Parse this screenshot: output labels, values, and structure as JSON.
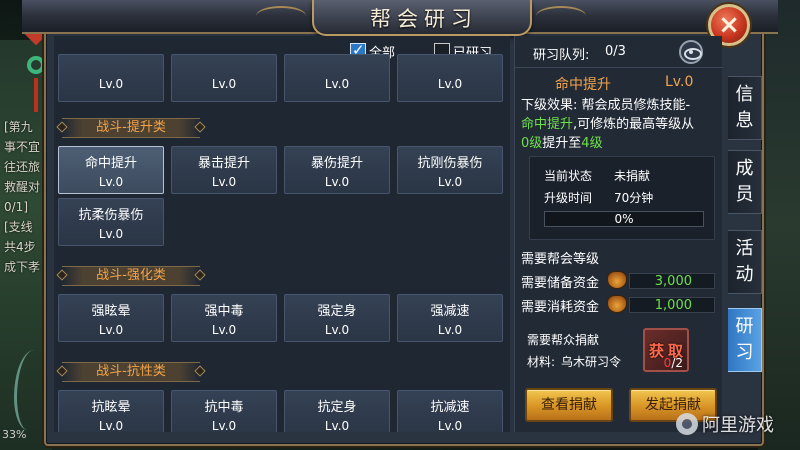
{
  "title": "帮会研习",
  "filters": {
    "all_label": "全部",
    "all_checked": true,
    "learned_label": "已研习",
    "learned_checked": false
  },
  "top_row": [
    {
      "name": "",
      "level": "Lv.0"
    },
    {
      "name": "",
      "level": "Lv.0"
    },
    {
      "name": "",
      "level": "Lv.0"
    },
    {
      "name": "",
      "level": "Lv.0"
    }
  ],
  "sections": [
    {
      "header": "战斗-提升类",
      "skills": [
        {
          "name": "命中提升",
          "level": "Lv.0"
        },
        {
          "name": "暴击提升",
          "level": "Lv.0"
        },
        {
          "name": "暴伤提升",
          "level": "Lv.0"
        },
        {
          "name": "抗刚伤暴伤",
          "level": "Lv.0"
        },
        {
          "name": "抗柔伤暴伤",
          "level": "Lv.0"
        }
      ]
    },
    {
      "header": "战斗-强化类",
      "skills": [
        {
          "name": "强眩晕",
          "level": "Lv.0"
        },
        {
          "name": "强中毒",
          "level": "Lv.0"
        },
        {
          "name": "强定身",
          "level": "Lv.0"
        },
        {
          "name": "强减速",
          "level": "Lv.0"
        }
      ]
    },
    {
      "header": "战斗-抗性类",
      "skills": [
        {
          "name": "抗眩晕",
          "level": "Lv.0"
        },
        {
          "name": "抗中毒",
          "level": "Lv.0"
        },
        {
          "name": "抗定身",
          "level": "Lv.0"
        },
        {
          "name": "抗减速",
          "level": "Lv.0"
        }
      ]
    }
  ],
  "detail": {
    "queue_label": "研习队列:",
    "queue_value": "0/3",
    "skill_name": "命中提升",
    "skill_level": "Lv.0",
    "desc_prefix": "下级效果:",
    "desc_line1_rest": "帮会成员修炼技能-",
    "desc_skill": "命中提升",
    "desc_mid": ",可修炼的最高等级从",
    "desc_from": "0级",
    "desc_to_word": "提升至",
    "desc_to": "4级",
    "status_label": "当前状态",
    "status_value": "未捐献",
    "time_label": "升级时间",
    "time_value": "70分钟",
    "progress_text": "0%",
    "progress": 0,
    "req_guild_level": "需要帮会等级",
    "req_reserve_label": "需要储备资金",
    "req_reserve_value": "3,000",
    "req_consume_label": "需要消耗资金",
    "req_consume_value": "1,000",
    "req_donate_label": "需要帮众捐献",
    "material_label": "材料:",
    "material_name": "乌木研习令",
    "material_get": "获取",
    "material_have": "0",
    "material_need": "/2",
    "view_donate_button": "查看捐献",
    "start_donate_button": "发起捐献"
  },
  "side_tabs": [
    {
      "label": "信息",
      "active": false
    },
    {
      "label": "成员",
      "active": false
    },
    {
      "label": "活动",
      "active": false
    },
    {
      "label": "研习",
      "active": true
    }
  ],
  "background": {
    "chat_lines": [
      "[第九",
      "事不宜",
      "往还旅",
      "救醒对",
      "0/1]",
      "[支线",
      "共4步",
      "成下孝"
    ],
    "zoom": "33%"
  },
  "watermark": "阿里游戏",
  "colors": {
    "accent_orange": "#f3a44a",
    "highlight_green": "#6ee04a",
    "active_tab_blue": "#3b88d4",
    "button_gold": "#e0a030"
  }
}
